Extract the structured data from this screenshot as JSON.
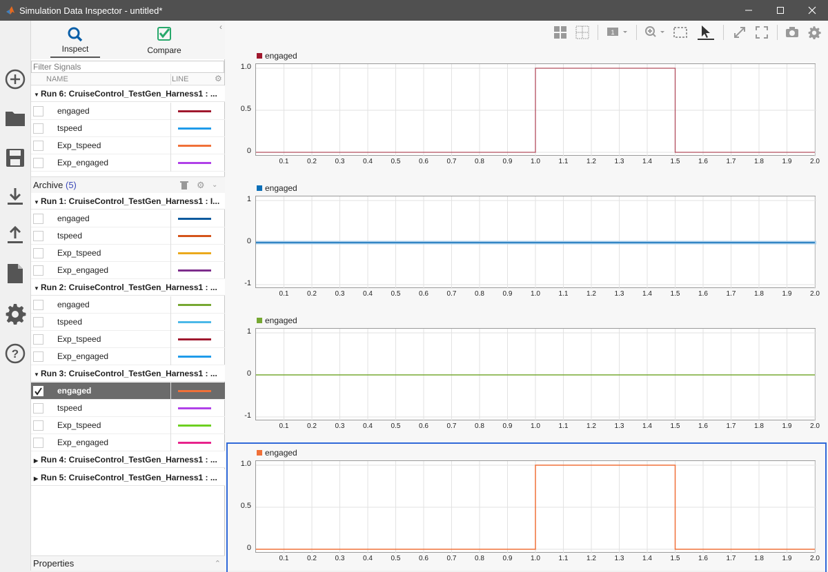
{
  "window": {
    "title": "Simulation Data Inspector - untitled*"
  },
  "tabs": [
    {
      "label": "Inspect"
    },
    {
      "label": "Compare"
    }
  ],
  "filter": {
    "placeholder": "Filter Signals"
  },
  "columns": {
    "name": "NAME",
    "line": "LINE"
  },
  "current_run": {
    "label": "Run 6: CruiseControl_TestGen_Harness1 : ...",
    "signals": [
      {
        "name": "engaged",
        "color": "#a0182e"
      },
      {
        "name": "tspeed",
        "color": "#1f9bea"
      },
      {
        "name": "Exp_tspeed",
        "color": "#f07038"
      },
      {
        "name": "Exp_engaged",
        "color": "#b040e8"
      }
    ]
  },
  "archive": {
    "label": "Archive",
    "count": "(5)",
    "runs": [
      {
        "label": "Run 1: CruiseControl_TestGen_Harness1 : I...",
        "expanded": true,
        "signals": [
          {
            "name": "engaged",
            "color": "#0c5a9e",
            "checked": false
          },
          {
            "name": "tspeed",
            "color": "#d4541a",
            "checked": false
          },
          {
            "name": "Exp_tspeed",
            "color": "#eba91c",
            "checked": false
          },
          {
            "name": "Exp_engaged",
            "color": "#7d2d8c",
            "checked": false
          }
        ]
      },
      {
        "label": "Run 2: CruiseControl_TestGen_Harness1 : ...",
        "expanded": true,
        "signals": [
          {
            "name": "engaged",
            "color": "#76a832",
            "checked": false
          },
          {
            "name": "tspeed",
            "color": "#4bb8e8",
            "checked": false
          },
          {
            "name": "Exp_tspeed",
            "color": "#a0182e",
            "checked": false
          },
          {
            "name": "Exp_engaged",
            "color": "#1f9bea",
            "checked": false
          }
        ]
      },
      {
        "label": "Run 3: CruiseControl_TestGen_Harness1 : ...",
        "expanded": true,
        "signals": [
          {
            "name": "engaged",
            "color": "#f07038",
            "checked": true
          },
          {
            "name": "tspeed",
            "color": "#b040e8",
            "checked": false
          },
          {
            "name": "Exp_tspeed",
            "color": "#6cd020",
            "checked": false
          },
          {
            "name": "Exp_engaged",
            "color": "#e8238c",
            "checked": false
          }
        ]
      },
      {
        "label": "Run 4: CruiseControl_TestGen_Harness1 : ...",
        "expanded": false,
        "signals": []
      },
      {
        "label": "Run 5: CruiseControl_TestGen_Harness1 : ...",
        "expanded": false,
        "signals": []
      }
    ]
  },
  "properties": {
    "label": "Properties"
  },
  "toolbar_icons": [
    "layout-grid-icon",
    "subplot-icon",
    "layout-number-icon",
    "zoom-in-icon",
    "fit-to-view-icon",
    "cursor-icon",
    "expand-icon",
    "fullscreen-icon",
    "camera-icon",
    "settings-icon"
  ],
  "sidebar_icons": [
    "new-icon",
    "open-folder-icon",
    "save-icon",
    "import-icon",
    "export-icon",
    "report-icon",
    "preferences-icon",
    "help-icon"
  ],
  "chart_data": [
    {
      "type": "line",
      "legend": "engaged",
      "color": "#a0182e",
      "x": [
        0,
        1.0,
        1.0,
        1.5,
        1.5,
        2.0
      ],
      "y": [
        0,
        0,
        1,
        1,
        0,
        0
      ],
      "ylim": [
        0,
        1
      ],
      "yticks": [
        "1.0",
        "0.5",
        "0"
      ],
      "xticks": [
        "0.1",
        "0.2",
        "0.3",
        "0.4",
        "0.5",
        "0.6",
        "0.7",
        "0.8",
        "0.9",
        "1.0",
        "1.1",
        "1.2",
        "1.3",
        "1.4",
        "1.5",
        "1.6",
        "1.7",
        "1.8",
        "1.9",
        "2.0"
      ],
      "selected": false
    },
    {
      "type": "line",
      "legend": "engaged",
      "color": "#0c6fb8",
      "x": [
        0,
        2.0
      ],
      "y": [
        0,
        0
      ],
      "ylim": [
        -1,
        1
      ],
      "yticks": [
        "1",
        "0",
        "-1"
      ],
      "xticks": [
        "0.1",
        "0.2",
        "0.3",
        "0.4",
        "0.5",
        "0.6",
        "0.7",
        "0.8",
        "0.9",
        "1.0",
        "1.1",
        "1.2",
        "1.3",
        "1.4",
        "1.5",
        "1.6",
        "1.7",
        "1.8",
        "1.9",
        "2.0"
      ],
      "selected": false
    },
    {
      "type": "line",
      "legend": "engaged",
      "color": "#76a832",
      "x": [
        0,
        2.0
      ],
      "y": [
        0,
        0
      ],
      "ylim": [
        -1,
        1
      ],
      "yticks": [
        "1",
        "0",
        "-1"
      ],
      "xticks": [
        "0.1",
        "0.2",
        "0.3",
        "0.4",
        "0.5",
        "0.6",
        "0.7",
        "0.8",
        "0.9",
        "1.0",
        "1.1",
        "1.2",
        "1.3",
        "1.4",
        "1.5",
        "1.6",
        "1.7",
        "1.8",
        "1.9",
        "2.0"
      ],
      "selected": false
    },
    {
      "type": "line",
      "legend": "engaged",
      "color": "#f07038",
      "x": [
        0,
        1.0,
        1.0,
        1.5,
        1.5,
        2.0
      ],
      "y": [
        0,
        0,
        1,
        1,
        0,
        0
      ],
      "ylim": [
        0,
        1
      ],
      "yticks": [
        "1.0",
        "0.5",
        "0"
      ],
      "xticks": [
        "0.1",
        "0.2",
        "0.3",
        "0.4",
        "0.5",
        "0.6",
        "0.7",
        "0.8",
        "0.9",
        "1.0",
        "1.1",
        "1.2",
        "1.3",
        "1.4",
        "1.5",
        "1.6",
        "1.7",
        "1.8",
        "1.9",
        "2.0"
      ],
      "selected": true
    }
  ]
}
